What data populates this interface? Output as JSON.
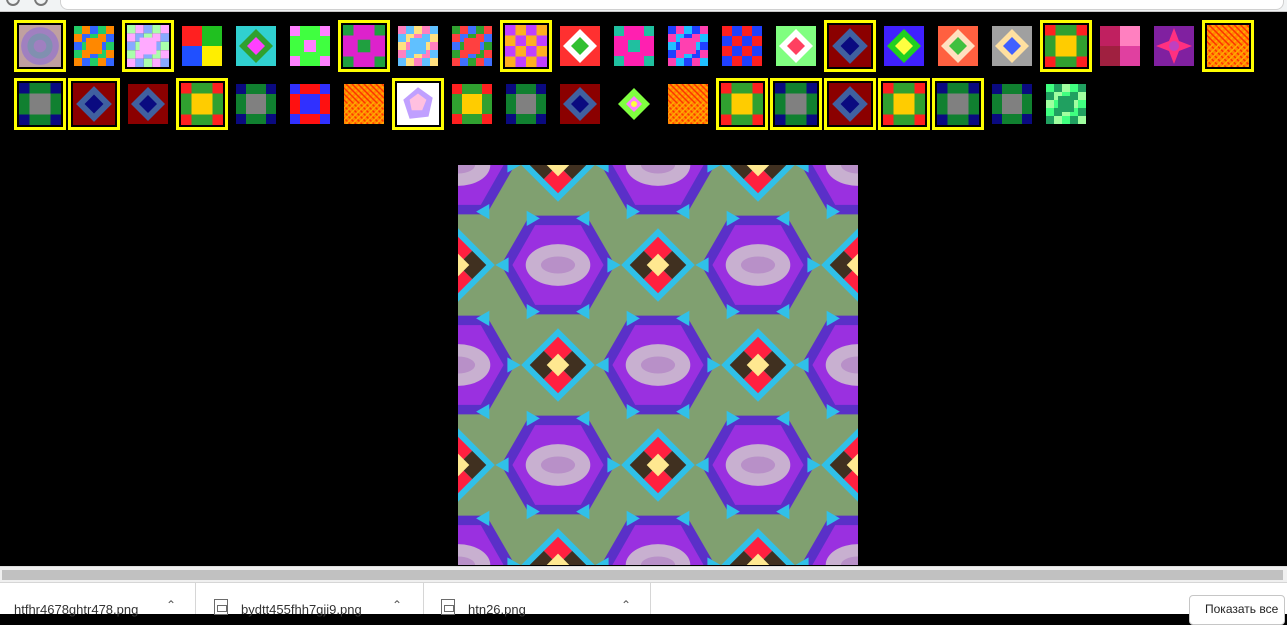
{
  "window": {
    "title": ""
  },
  "gallery": {
    "thumbnails": [
      {
        "name": "thumb-kaleido-1",
        "pattern": "radial",
        "colors": [
          "#a080c0",
          "#8090b0",
          "#c0a0a0"
        ],
        "selected": true
      },
      {
        "name": "thumb-grid-2",
        "pattern": "grid",
        "colors": [
          "#22cc66",
          "#ff8800",
          "#3366ff"
        ],
        "selected": false
      },
      {
        "name": "thumb-grid-3",
        "pattern": "grid",
        "colors": [
          "#aaffaa",
          "#ffaaff",
          "#88aaff"
        ],
        "selected": true
      },
      {
        "name": "thumb-quad-4",
        "pattern": "quad",
        "colors": [
          "#ff2020",
          "#20c020",
          "#2050ff",
          "#ffee00"
        ],
        "selected": false
      },
      {
        "name": "thumb-diamond-5",
        "pattern": "diamond",
        "colors": [
          "#30d0d0",
          "#30a030",
          "#ff40ff"
        ],
        "selected": false
      },
      {
        "name": "thumb-cross-6",
        "pattern": "cross",
        "colors": [
          "#40ff40",
          "#ff80ff",
          "#40ff40"
        ],
        "selected": false
      },
      {
        "name": "thumb-cross-7",
        "pattern": "cross",
        "colors": [
          "#dd22cc",
          "#20a040",
          "#dd22cc"
        ],
        "selected": true
      },
      {
        "name": "thumb-grid-8",
        "pattern": "grid",
        "colors": [
          "#ff80c0",
          "#60c0ff",
          "#ffe080"
        ],
        "selected": false
      },
      {
        "name": "thumb-grid-9",
        "pattern": "grid",
        "colors": [
          "#30a030",
          "#ff4040",
          "#4070ff"
        ],
        "selected": false
      },
      {
        "name": "thumb-checker-10",
        "pattern": "checker",
        "colors": [
          "#c040ff",
          "#ffb020",
          "#c040ff"
        ],
        "selected": true
      },
      {
        "name": "thumb-diamond-11",
        "pattern": "diamond",
        "colors": [
          "#ff3030",
          "#ffffff",
          "#30c030"
        ],
        "selected": false
      },
      {
        "name": "thumb-cross-12",
        "pattern": "cross",
        "colors": [
          "#ff20b0",
          "#20c0a0",
          "#ff20b0"
        ],
        "selected": false
      },
      {
        "name": "thumb-grid-13",
        "pattern": "grid",
        "colors": [
          "#2040ff",
          "#ff40b0",
          "#20c0ff"
        ],
        "selected": false
      },
      {
        "name": "thumb-checker-14",
        "pattern": "checker",
        "colors": [
          "#ff2020",
          "#2040ff",
          "#20c020"
        ],
        "selected": false
      },
      {
        "name": "thumb-diamond-15",
        "pattern": "diamond",
        "colors": [
          "#80ff80",
          "#ffffff",
          "#ff4060"
        ],
        "selected": false
      },
      {
        "name": "thumb-diamond-16",
        "pattern": "diamond",
        "colors": [
          "#8b0000",
          "#4060a0",
          "#0a0a80"
        ],
        "selected": true
      },
      {
        "name": "thumb-diamond-17",
        "pattern": "diamond",
        "colors": [
          "#4020ff",
          "#20d020",
          "#ffff40"
        ],
        "selected": false
      },
      {
        "name": "thumb-diamond-18",
        "pattern": "diamond",
        "colors": [
          "#ff6040",
          "#ffe0c0",
          "#40c040"
        ],
        "selected": false
      },
      {
        "name": "thumb-diamond-19",
        "pattern": "diamond",
        "colors": [
          "#a0a0a0",
          "#ffe0a0",
          "#4060ff"
        ],
        "selected": false
      },
      {
        "name": "thumb-frame-20",
        "pattern": "frame",
        "colors": [
          "#30a030",
          "#ff2020",
          "#ffcc00"
        ],
        "selected": true
      },
      {
        "name": "thumb-quad-21",
        "pattern": "quad",
        "colors": [
          "#c02060",
          "#ff80c0",
          "#a02040",
          "#e040a0"
        ],
        "selected": false
      },
      {
        "name": "thumb-star-22",
        "pattern": "star",
        "colors": [
          "#8020a0",
          "#ff3080",
          "#c040c0"
        ],
        "selected": false
      },
      {
        "name": "thumb-mesh-23",
        "pattern": "mesh",
        "colors": [
          "#ff8800",
          "#ff3300",
          "#ffaa00"
        ],
        "selected": true
      },
      {
        "name": "thumb-frame-24",
        "pattern": "frame",
        "colors": [
          "#108030",
          "#0a0a80",
          "#808080"
        ],
        "selected": true
      },
      {
        "name": "thumb-diamond-25",
        "pattern": "diamond",
        "colors": [
          "#8b0000",
          "#4060a0",
          "#0a0a80"
        ],
        "selected": true
      },
      {
        "name": "thumb-diamond-26",
        "pattern": "diamond",
        "colors": [
          "#8b0000",
          "#4060a0",
          "#0a0a80"
        ],
        "selected": false
      },
      {
        "name": "thumb-frame-27",
        "pattern": "frame",
        "colors": [
          "#30a030",
          "#ff2020",
          "#ffcc00"
        ],
        "selected": true
      },
      {
        "name": "thumb-frame-28",
        "pattern": "frame",
        "colors": [
          "#108030",
          "#0a0a80",
          "#808080"
        ],
        "selected": false
      },
      {
        "name": "thumb-frame-29",
        "pattern": "frame",
        "colors": [
          "#ff1010",
          "#3030ff",
          "#3030ff"
        ],
        "selected": false
      },
      {
        "name": "thumb-mesh-30",
        "pattern": "mesh",
        "colors": [
          "#ff8800",
          "#ff3300",
          "#ffaa00"
        ],
        "selected": false
      },
      {
        "name": "thumb-gem-31",
        "pattern": "gem",
        "colors": [
          "#ffffff",
          "#c0a0ff",
          "#ffc0e0"
        ],
        "selected": true
      },
      {
        "name": "thumb-frame-32",
        "pattern": "frame",
        "colors": [
          "#30a030",
          "#ff2020",
          "#ffcc00"
        ],
        "selected": false
      },
      {
        "name": "thumb-frame-33",
        "pattern": "frame",
        "colors": [
          "#108030",
          "#0a0a80",
          "#808080"
        ],
        "selected": false
      },
      {
        "name": "thumb-diamond-34",
        "pattern": "diamond",
        "colors": [
          "#8b0000",
          "#4060a0",
          "#0a0a80"
        ],
        "selected": false
      },
      {
        "name": "thumb-tilt-35",
        "pattern": "tilt",
        "colors": [
          "#80ff40",
          "#ff80ff",
          "#ffff40"
        ],
        "selected": false
      },
      {
        "name": "thumb-mesh-36",
        "pattern": "mesh",
        "colors": [
          "#ff8800",
          "#ff3300",
          "#ffaa00"
        ],
        "selected": false
      },
      {
        "name": "thumb-frame-37",
        "pattern": "frame",
        "colors": [
          "#30a030",
          "#ff2020",
          "#ffcc00"
        ],
        "selected": true
      },
      {
        "name": "thumb-frame-38",
        "pattern": "frame",
        "colors": [
          "#108030",
          "#0a0a80",
          "#808080"
        ],
        "selected": true
      },
      {
        "name": "thumb-diamond-39",
        "pattern": "diamond",
        "colors": [
          "#8b0000",
          "#4060a0",
          "#0a0a80"
        ],
        "selected": true
      },
      {
        "name": "thumb-frame-40",
        "pattern": "frame",
        "colors": [
          "#30a030",
          "#ff2020",
          "#ffcc00"
        ],
        "selected": true
      },
      {
        "name": "thumb-frame-41",
        "pattern": "frame",
        "colors": [
          "#108030",
          "#0a0a80",
          "#808080"
        ],
        "selected": true
      },
      {
        "name": "thumb-frame-42",
        "pattern": "frame",
        "colors": [
          "#108030",
          "#0a0a80",
          "#808080"
        ],
        "selected": false
      },
      {
        "name": "thumb-grid-43",
        "pattern": "grid",
        "colors": [
          "#40ff80",
          "#20a060",
          "#a0ffa0"
        ],
        "selected": false
      }
    ],
    "selection_color": "#ffff00",
    "background": "#000000"
  },
  "main_image": {
    "palette": [
      "#5a30c8",
      "#30c0e8",
      "#9a30e0",
      "#ff2040",
      "#ffe890",
      "#403020",
      "#80a070",
      "#c8b0d0"
    ]
  },
  "downloads": {
    "items": [
      {
        "file_name": "htfhr4678ghtr478.png"
      },
      {
        "file_name": "bydtt455fhh7gji9.png"
      },
      {
        "file_name": "htn26.png"
      }
    ],
    "show_all_label": "Показать все"
  }
}
